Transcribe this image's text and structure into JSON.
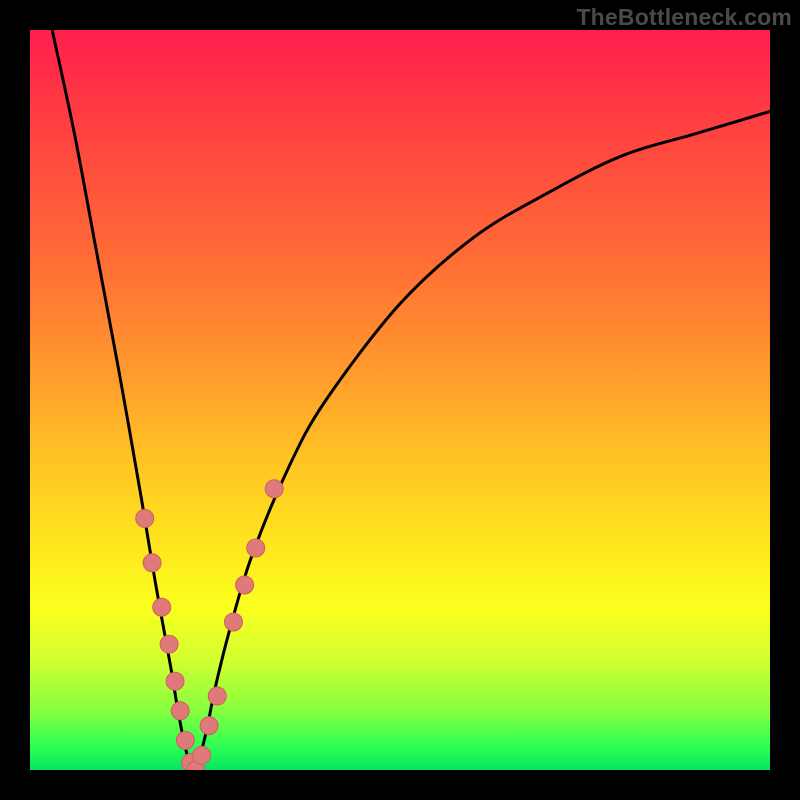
{
  "watermark": "TheBottleneck.com",
  "colors": {
    "frame": "#000000",
    "curve": "#000000",
    "dot_fill": "#e07a7a",
    "dot_stroke": "#ce5f5f"
  },
  "chart_data": {
    "type": "line",
    "title": "",
    "xlabel": "",
    "ylabel": "",
    "xlim": [
      0,
      100
    ],
    "ylim": [
      0,
      100
    ],
    "grid": false,
    "curve_note": "V-shaped bottleneck curve; y≈0 at minimum near x≈22, rising steeply on the left branch and more slowly on the right",
    "series": [
      {
        "name": "bottleneck-curve",
        "x": [
          3,
          6,
          9,
          12,
          15,
          17,
          19,
          20,
          21,
          22,
          23,
          24,
          25,
          27,
          30,
          35,
          40,
          50,
          60,
          70,
          80,
          90,
          100
        ],
        "y": [
          100,
          86,
          70,
          54,
          37,
          25,
          14,
          8,
          3,
          0,
          2,
          6,
          11,
          19,
          29,
          41,
          50,
          63,
          72,
          78,
          83,
          86,
          89
        ]
      },
      {
        "name": "data-points",
        "type": "scatter",
        "x": [
          15.5,
          16.5,
          17.8,
          18.8,
          19.6,
          20.3,
          21.0,
          21.7,
          22.4,
          23.2,
          24.2,
          25.3,
          27.5,
          29.0,
          30.5,
          33.0
        ],
        "y": [
          34,
          28,
          22,
          17,
          12,
          8,
          4,
          1,
          0,
          2,
          6,
          10,
          20,
          25,
          30,
          38
        ]
      }
    ]
  }
}
